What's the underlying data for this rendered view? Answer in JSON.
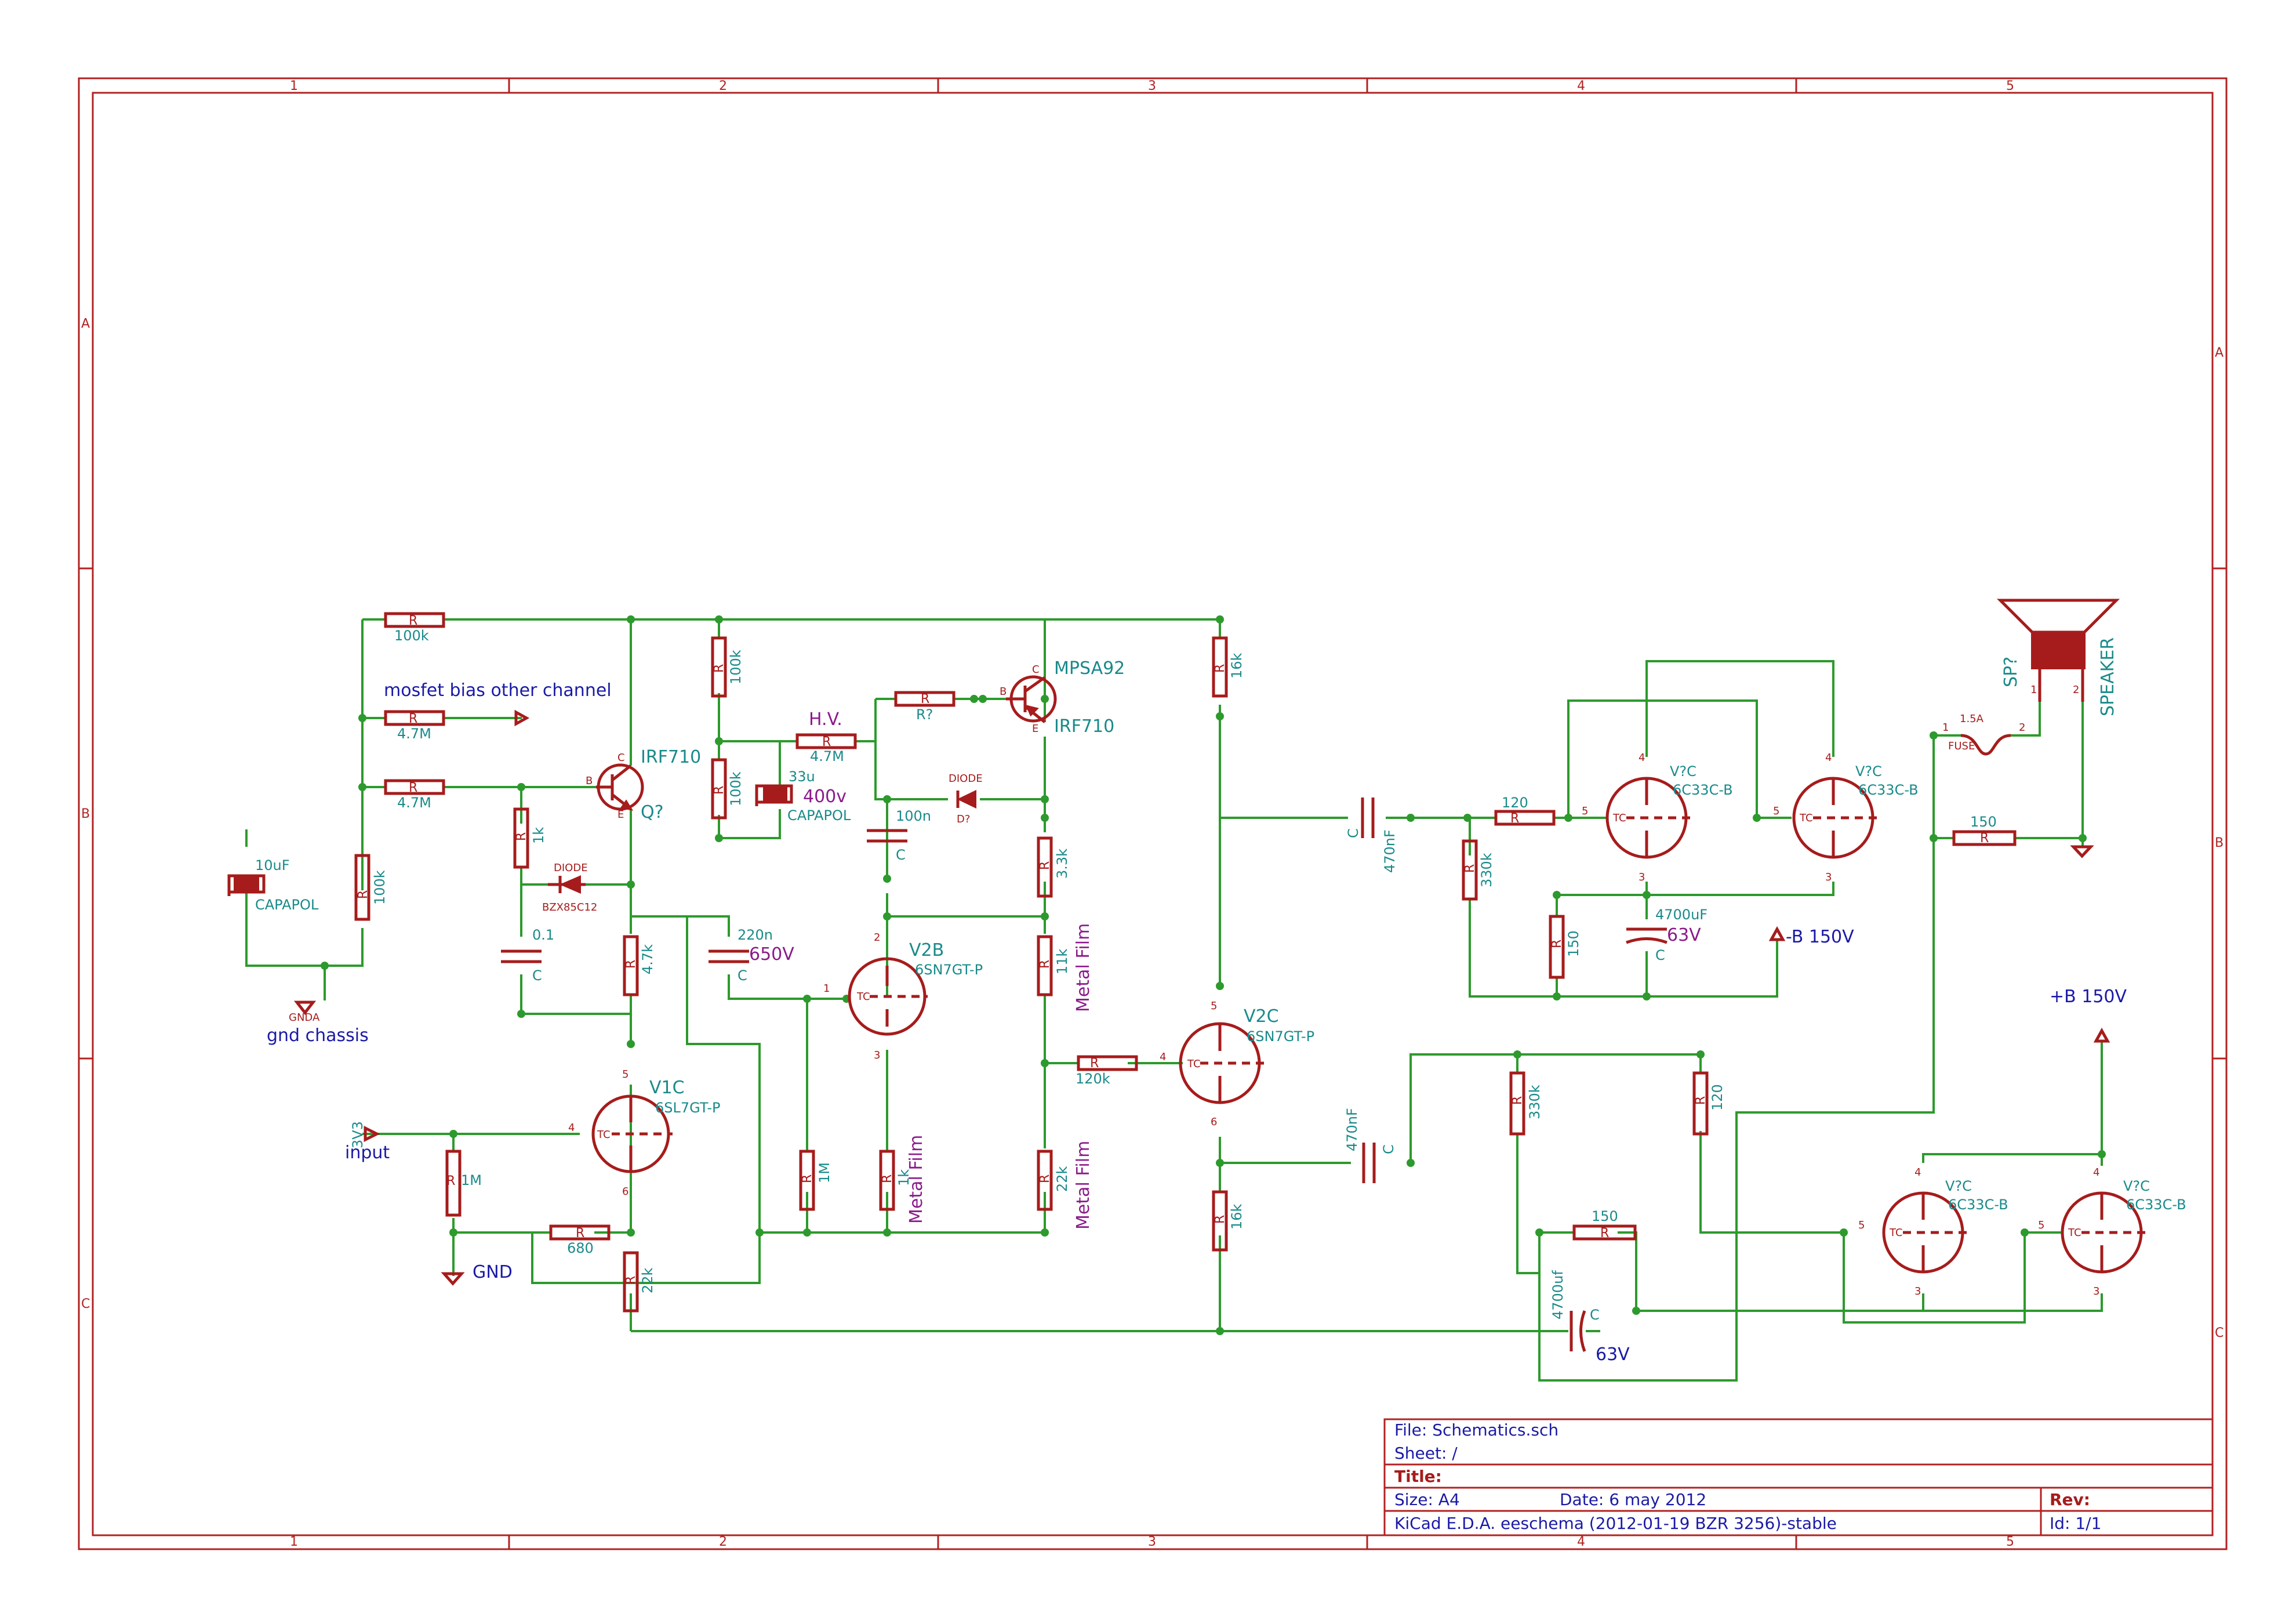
{
  "title_block": {
    "file": "File: Schematics.sch",
    "sheet": "Sheet: /",
    "title": "Title:",
    "size": "Size: A4",
    "date": "Date: 6 may 2012",
    "rev": "Rev:",
    "tool": "KiCad E.D.A.  eeschema (2012-01-19 BZR 3256)-stable",
    "id": "Id: 1/1"
  },
  "grid": {
    "columns": [
      "1",
      "2",
      "3",
      "4",
      "5"
    ],
    "rows": [
      "A",
      "B",
      "C"
    ]
  },
  "components": {
    "r100k_top": {
      "ref": "R",
      "value": "100k"
    },
    "r47m_a": {
      "ref": "R",
      "value": "4.7M"
    },
    "r47m_b": {
      "ref": "R",
      "value": "4.7M"
    },
    "r100k_left": {
      "ref": "R",
      "value": "100k"
    },
    "c10u": {
      "value": "10uF",
      "type": "CAPAPOL"
    },
    "r1k_bias": {
      "ref": "R",
      "value": "1k"
    },
    "diode1": {
      "name": "DIODE",
      "value": "BZX85C12"
    },
    "c01": {
      "ref": "C",
      "value": "0.1"
    },
    "r47k": {
      "ref": "R",
      "value": "4.7k"
    },
    "q1": {
      "value": "IRF710",
      "ref": "Q?"
    },
    "r100k_a": {
      "ref": "R",
      "value": "100k"
    },
    "r100k_b": {
      "ref": "R",
      "value": "100k"
    },
    "rhv": {
      "ref": "R",
      "value": "4.7M",
      "label": "H.V."
    },
    "c33u": {
      "value": "33u",
      "type": "CAPAPOL",
      "voltage": "400v"
    },
    "c220n": {
      "value": "220n",
      "ref": "C",
      "voltage": "650V"
    },
    "rq": {
      "ref": "R",
      "value": "R?"
    },
    "q2": {
      "value": "MPSA92",
      "value2": "IRF710"
    },
    "diode2": {
      "name": "DIODE",
      "ref": "D?"
    },
    "c100n": {
      "value": "100n",
      "ref": "C"
    },
    "r33k": {
      "ref": "R",
      "value": "3.3k"
    },
    "r11k": {
      "ref": "R",
      "value": "11k",
      "note": "Metal Film"
    },
    "v2b": {
      "ref": "V2B",
      "value": "6SN7GT-P"
    },
    "r1m_a": {
      "ref": "R",
      "value": "1M"
    },
    "r1k_b": {
      "ref": "R",
      "value": "1k",
      "note": "Metal Film"
    },
    "r22k_a": {
      "ref": "R",
      "value": "22k",
      "note": "Metal Film"
    },
    "v1c": {
      "ref": "V1C",
      "value": "6SL7GT-P"
    },
    "r1m_b": {
      "ref": "R",
      "value": "1M"
    },
    "r680": {
      "ref": "R",
      "value": "680"
    },
    "r22k_b": {
      "ref": "R",
      "value": "22k"
    },
    "r16k_a": {
      "ref": "R",
      "value": "16k"
    },
    "r16k_b": {
      "ref": "R",
      "value": "16k"
    },
    "r120k": {
      "ref": "R",
      "value": "120k"
    },
    "v2c": {
      "ref": "V2C",
      "value": "6SN7GT-P"
    },
    "c470n_a": {
      "ref": "C",
      "value": "470nF"
    },
    "c470n_b": {
      "ref": "C",
      "value": "470nF"
    },
    "r120_a": {
      "ref": "R",
      "value": "120"
    },
    "r330k_a": {
      "ref": "R",
      "value": "330k"
    },
    "r150_a": {
      "ref": "R",
      "value": "150"
    },
    "c4700_a": {
      "value": "4700uF",
      "ref": "C",
      "voltage": "63V"
    },
    "vtop1": {
      "ref": "V?C",
      "value": "6C33C-B"
    },
    "vtop2": {
      "ref": "V?C",
      "value": "6C33C-B"
    },
    "r330k_b": {
      "ref": "R",
      "value": "330k"
    },
    "r120_b": {
      "ref": "R",
      "value": "120"
    },
    "r150_b": {
      "ref": "R",
      "value": "150"
    },
    "c4700_b": {
      "value": "4700uf",
      "ref": "C",
      "voltage": "63V"
    },
    "vbot1": {
      "ref": "V?C",
      "value": "6C33C-B"
    },
    "vbot2": {
      "ref": "V?C",
      "value": "6C33C-B"
    },
    "r150_out": {
      "ref": "R",
      "value": "150"
    },
    "fuse": {
      "value": "1.5A",
      "name": "FUSE"
    },
    "speaker": {
      "ref": "SP?",
      "value": "SPEAKER"
    }
  },
  "labels": {
    "bias_note": "mosfet bias other channel",
    "gnd_chassis": "gnd chassis",
    "gnda": "GNDA",
    "input": "input",
    "input_net": "3V3",
    "gnd": "GND",
    "neg_b": "-B 150V",
    "pos_b": "+B 150V"
  },
  "colors": {
    "frame": "#b22222",
    "wire": "#2d9a2d",
    "component": "#a61c1c",
    "value_text": "#1a8a8a",
    "net_text": "#1a1aa6",
    "note_text": "#8b1a8b"
  }
}
